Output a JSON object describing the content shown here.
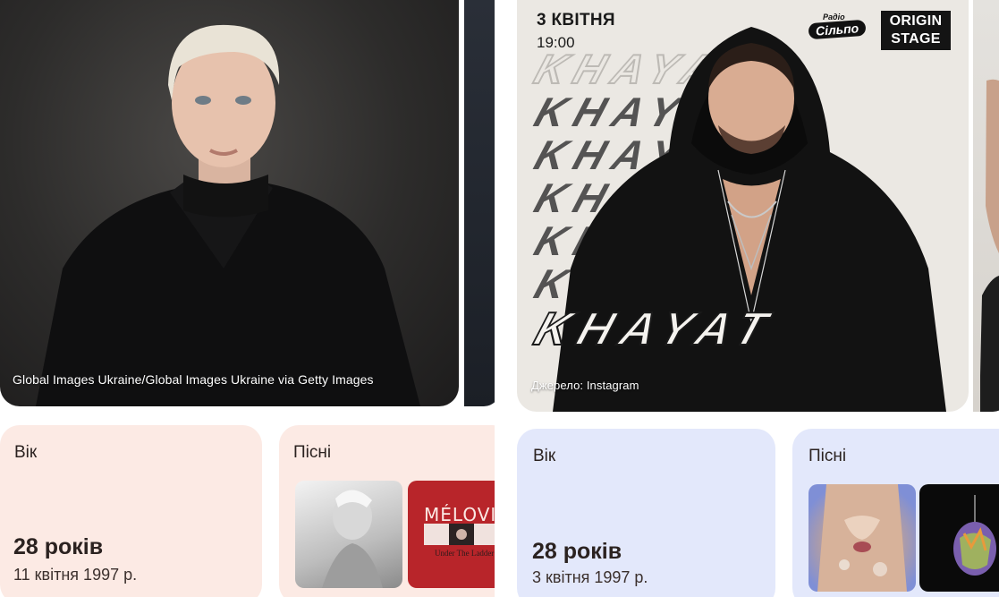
{
  "left": {
    "photo_credit": "Global Images Ukraine/Global Images Ukraine via Getty Images",
    "age_label": "Вік",
    "age_value": "28 років",
    "birth_date": "11 квітня 1997 р.",
    "songs_label": "Пісні",
    "album_title": "MÉLOVIN",
    "album_subtitle": "Under The Ladder"
  },
  "right": {
    "poster": {
      "date": "3 КВІТНЯ",
      "time": "19:00",
      "radio_top": "Радіо",
      "radio_name": "Сільпо",
      "venue_line1": "ORIGIN",
      "venue_line2": "STAGE",
      "wordmark": "KHAYAT"
    },
    "photo_credit": "Джерело: Instagram",
    "age_label": "Вік",
    "age_value": "28 років",
    "birth_date": "3 квітня 1997 р.",
    "songs_label": "Пісні"
  },
  "colors": {
    "left_card_bg": "#fceae4",
    "right_card_bg": "#e3e8fb",
    "text_dark": "#2b2220"
  }
}
